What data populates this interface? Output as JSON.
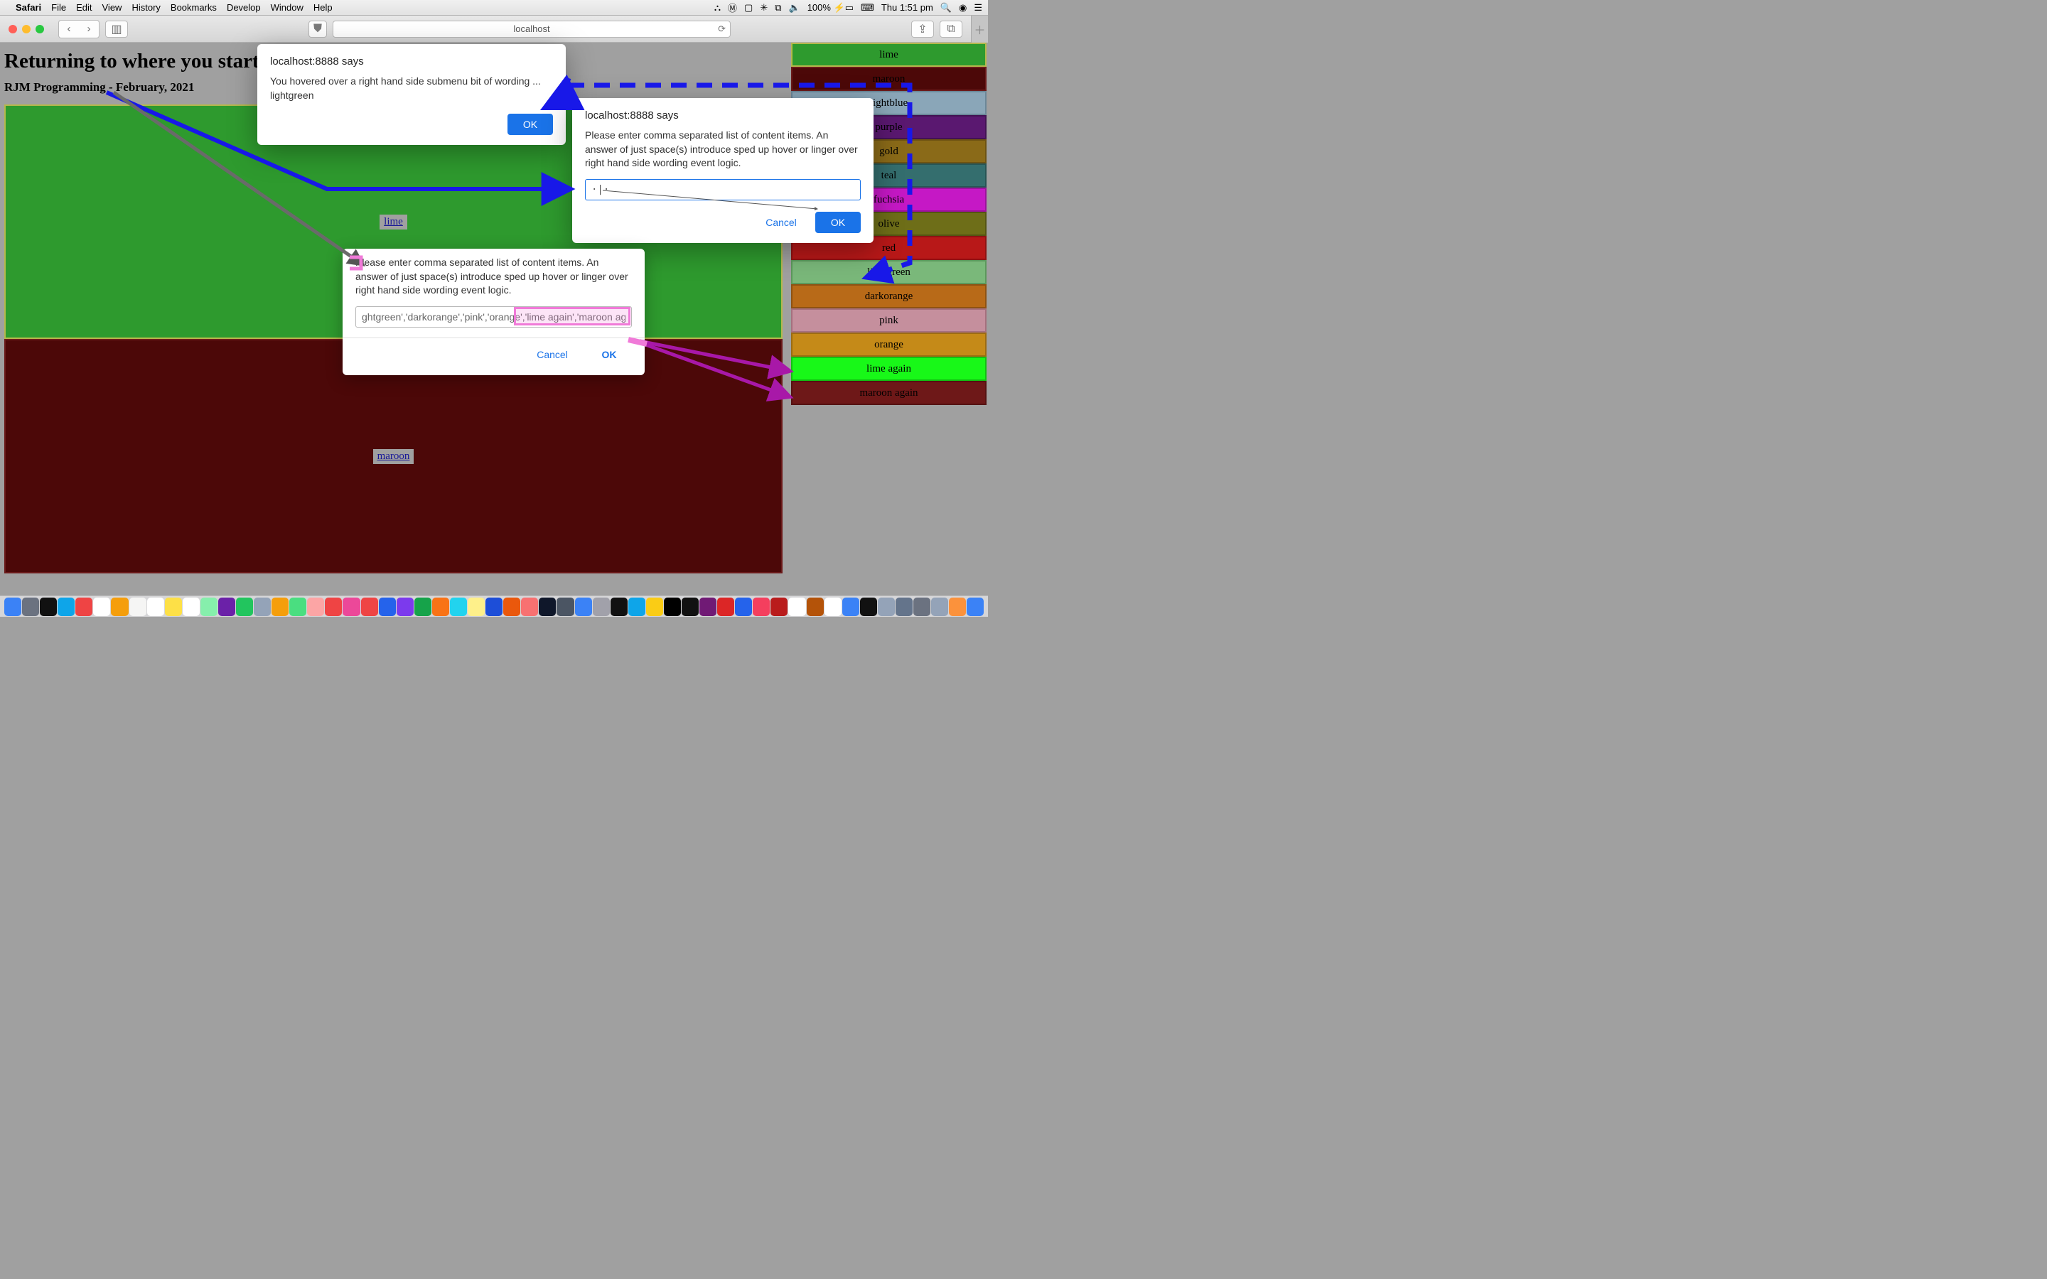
{
  "menubar": {
    "apple": "",
    "app": "Safari",
    "items": [
      "File",
      "Edit",
      "View",
      "History",
      "Bookmarks",
      "Develop",
      "Window",
      "Help"
    ],
    "right": {
      "battery": "100%",
      "clock": "Thu 1:51 pm"
    }
  },
  "toolbar": {
    "address": "localhost"
  },
  "page": {
    "heading": "Returning to where you started",
    "subheading": "RJM Programming - February, 2021",
    "panel_a_label": "lime",
    "panel_b_label": "maroon"
  },
  "sidebar": {
    "items": [
      {
        "label": "lime",
        "cls": "c-lime"
      },
      {
        "label": "maroon",
        "cls": "c-maroon"
      },
      {
        "label": "lightblue",
        "cls": "c-lightblue"
      },
      {
        "label": "purple",
        "cls": "c-purple"
      },
      {
        "label": "gold",
        "cls": "c-gold"
      },
      {
        "label": "teal",
        "cls": "c-teal"
      },
      {
        "label": "fuchsia",
        "cls": "c-fuchsia"
      },
      {
        "label": "olive",
        "cls": "c-olive"
      },
      {
        "label": "red",
        "cls": "c-red"
      },
      {
        "label": "lightgreen",
        "cls": "c-lightgreen"
      },
      {
        "label": "darkorange",
        "cls": "c-darkorange"
      },
      {
        "label": "pink",
        "cls": "c-pink"
      },
      {
        "label": "orange",
        "cls": "c-orange"
      },
      {
        "label": "lime again",
        "cls": "c-limeagain"
      },
      {
        "label": "maroon again",
        "cls": "c-maroonag"
      }
    ]
  },
  "dialog1": {
    "title": "localhost:8888 says",
    "line1": "You hovered over a right hand side submenu bit of wording ...",
    "line2": "lightgreen",
    "ok": "OK"
  },
  "dialog2": {
    "title": "localhost:8888 says",
    "text": "Please enter comma separated list of content items.  An answer of just space(s) introduce sped up hover or linger over right hand side wording event logic.",
    "input_value": "·|·",
    "cancel": "Cancel",
    "ok": "OK"
  },
  "dialog3": {
    "text": "Please enter comma separated list of content items.  An answer of just space(s) introduce sped up hover or linger over right hand side wording event logic.",
    "input_value": "ghtgreen','darkorange','pink','orange','lime again','maroon again'",
    "cancel": "Cancel",
    "ok": "OK"
  }
}
